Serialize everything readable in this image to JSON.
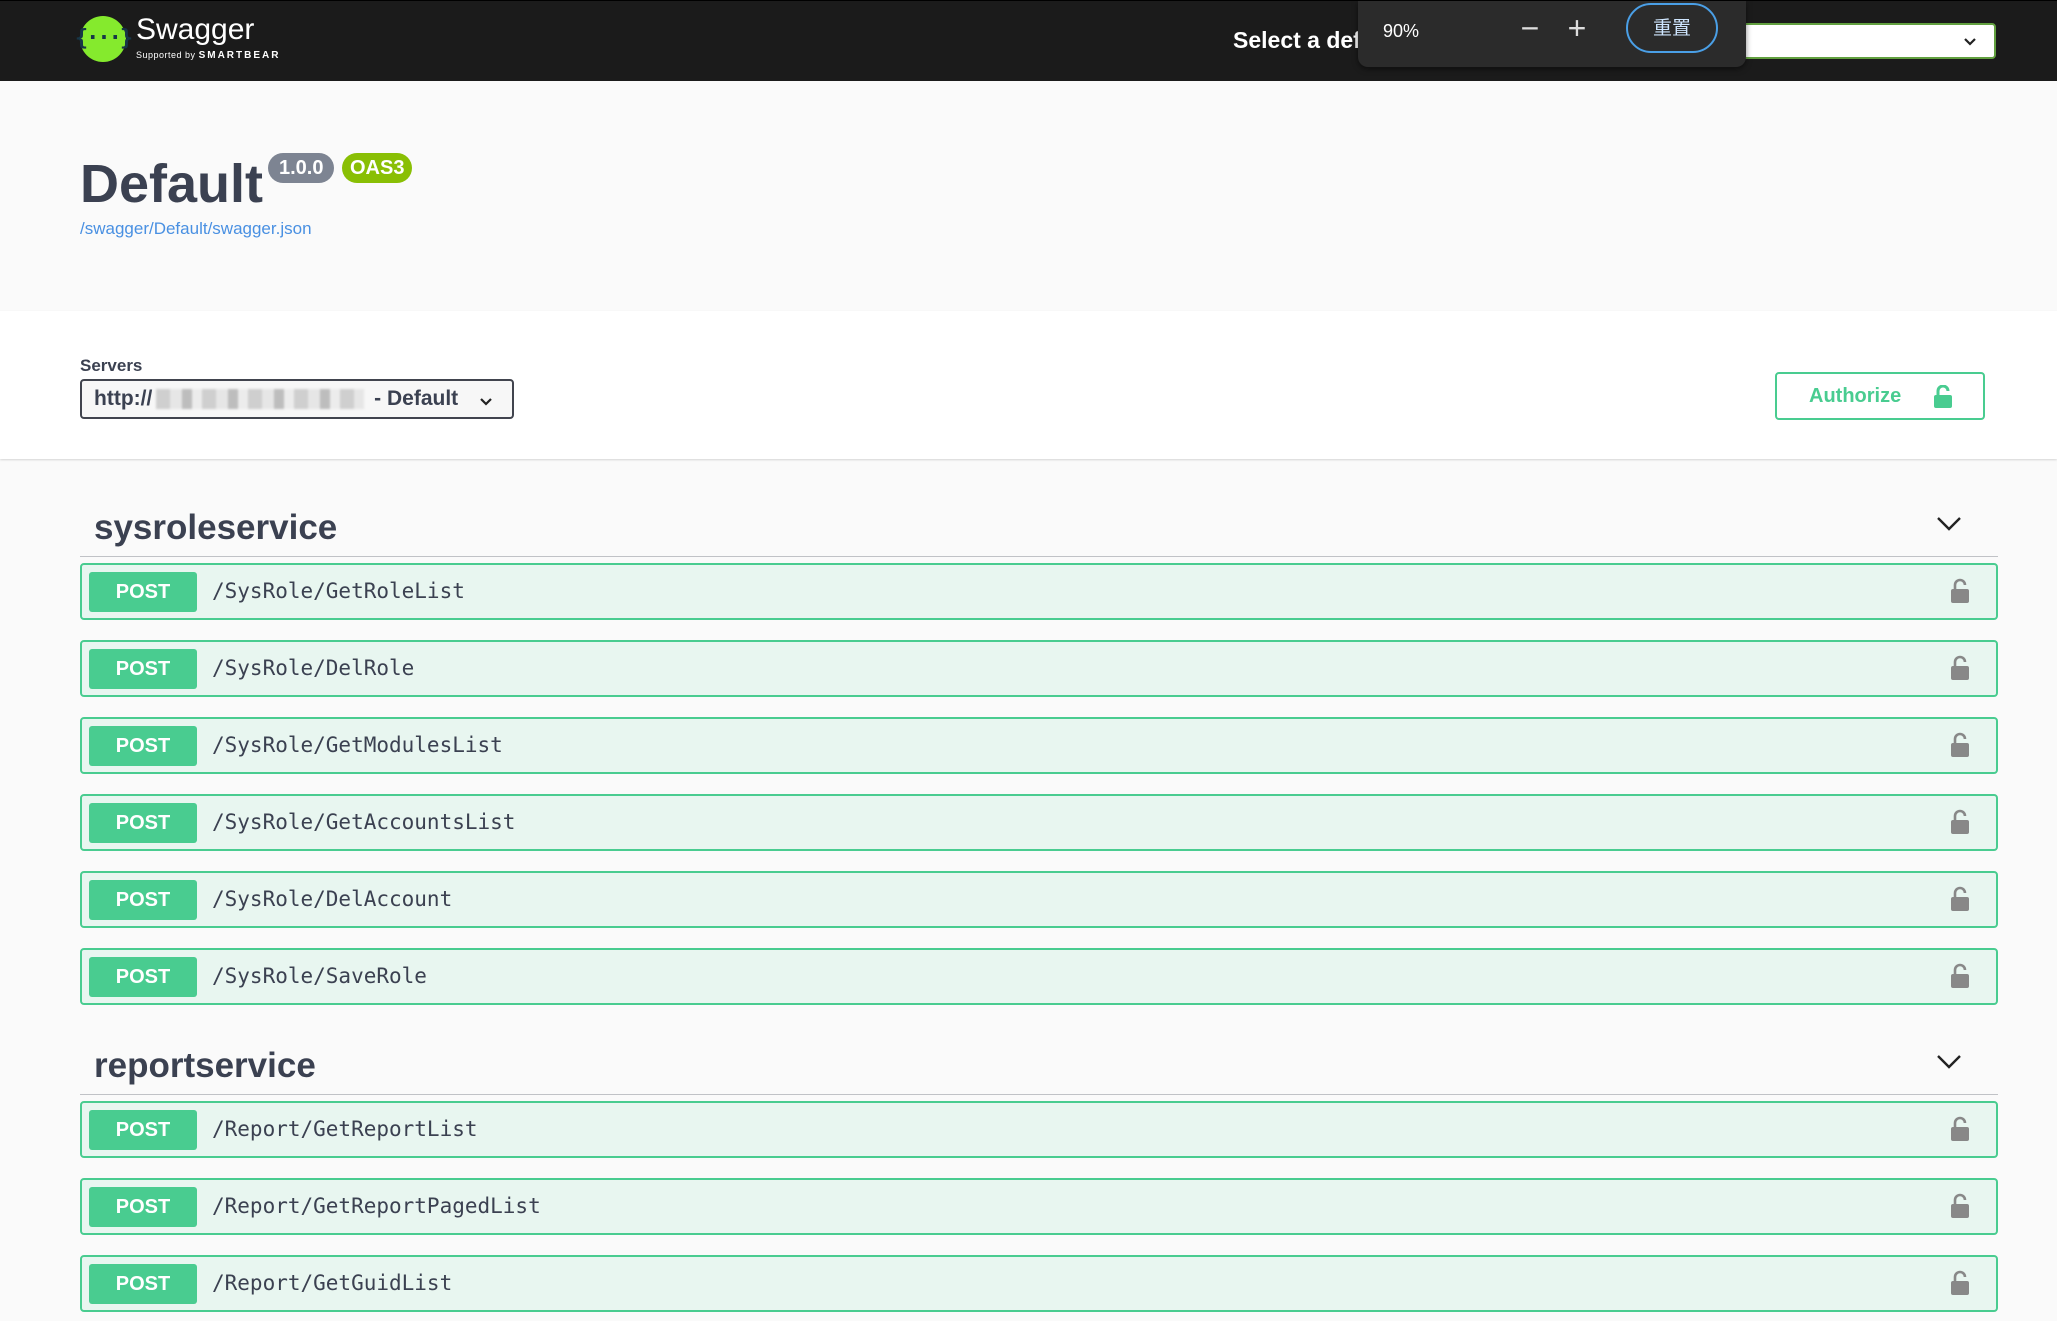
{
  "topbar": {
    "logo_title": "Swagger",
    "logo_sub_prefix": "Supported by",
    "logo_sub_brand": "SMARTBEAR",
    "select_label": "Select a def",
    "zoom": {
      "percent": "90%",
      "minus": "−",
      "plus": "+",
      "reset": "重置"
    }
  },
  "info": {
    "title": "Default",
    "version": "1.0.0",
    "oas": "OAS3",
    "spec_url": "/swagger/Default/swagger.json"
  },
  "servers": {
    "label": "Servers",
    "prefix": "http://",
    "suffix": " - Default"
  },
  "authorize": {
    "label": "Authorize"
  },
  "groups": [
    {
      "name": "sysroleservice",
      "operations": [
        {
          "method": "POST",
          "path": "/SysRole/GetRoleList"
        },
        {
          "method": "POST",
          "path": "/SysRole/DelRole"
        },
        {
          "method": "POST",
          "path": "/SysRole/GetModulesList"
        },
        {
          "method": "POST",
          "path": "/SysRole/GetAccountsList"
        },
        {
          "method": "POST",
          "path": "/SysRole/DelAccount"
        },
        {
          "method": "POST",
          "path": "/SysRole/SaveRole"
        }
      ]
    },
    {
      "name": "reportservice",
      "operations": [
        {
          "method": "POST",
          "path": "/Report/GetReportList"
        },
        {
          "method": "POST",
          "path": "/Report/GetReportPagedList"
        },
        {
          "method": "POST",
          "path": "/Report/GetGuidList"
        }
      ]
    }
  ],
  "colors": {
    "post": "#49cc90",
    "topbar": "#1b1b1b",
    "text": "#3b4151"
  }
}
